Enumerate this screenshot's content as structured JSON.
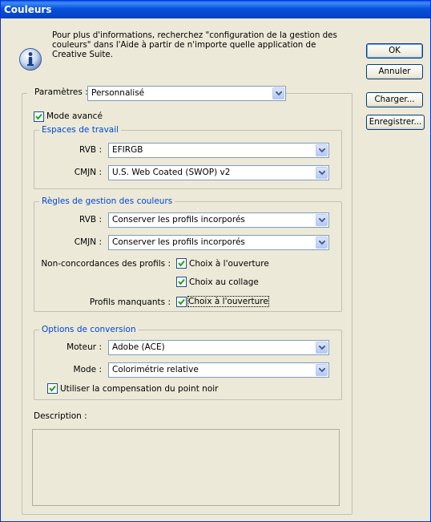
{
  "window": {
    "title": "Couleurs"
  },
  "info": {
    "text": "Pour plus d'informations, recherchez \"configuration de la gestion des couleurs\" dans l'Aide à partir de n'importe quelle application de Creative Suite."
  },
  "buttons": {
    "ok": "OK",
    "cancel": "Annuler",
    "load": "Charger...",
    "save": "Enregistrer..."
  },
  "settings": {
    "label": "Paramètres :",
    "value": "Personnalisé"
  },
  "advanced": {
    "label": "Mode avancé",
    "checked": true
  },
  "workspaces": {
    "title": "Espaces de travail",
    "rgb_label": "RVB :",
    "rgb_value": "EFIRGB",
    "cmyk_label": "CMJN :",
    "cmyk_value": "U.S. Web Coated (SWOP) v2"
  },
  "policies": {
    "title": "Règles de gestion des couleurs",
    "rgb_label": "RVB :",
    "rgb_value": "Conserver les profils incorporés",
    "cmyk_label": "CMJN :",
    "cmyk_value": "Conserver les profils incorporés",
    "mismatch_label": "Non-concordances des profils :",
    "ask_open_label": "Choix à l'ouverture",
    "ask_paste_label": "Choix au collage",
    "missing_label": "Profils manquants :",
    "missing_ask_open_label": "Choix à l'ouverture"
  },
  "conversion": {
    "title": "Options de conversion",
    "engine_label": "Moteur :",
    "engine_value": "Adobe (ACE)",
    "intent_label": "Mode :",
    "intent_value": "Colorimétrie relative",
    "bpc_label": "Utiliser la compensation du point noir"
  },
  "description": {
    "label": "Description :"
  }
}
